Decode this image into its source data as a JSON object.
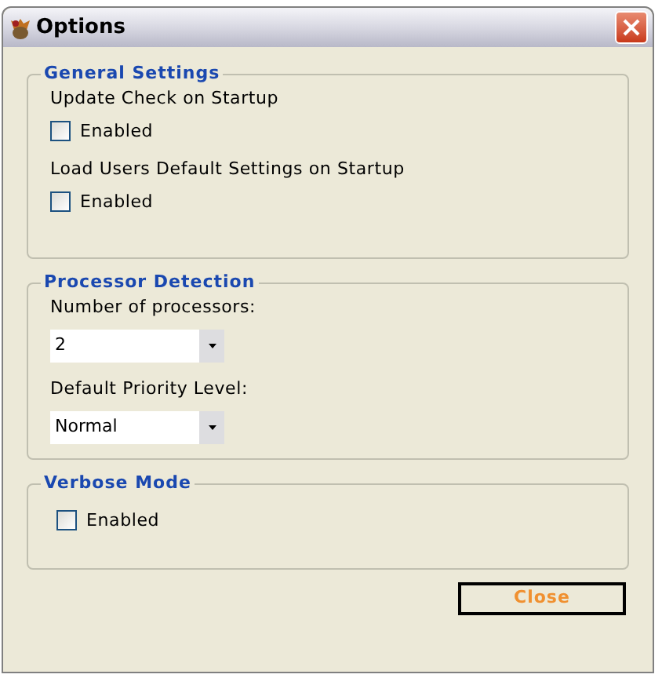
{
  "window": {
    "title": "Options"
  },
  "groups": [
    {
      "title": "General Settings",
      "items": [
        {
          "kind": "checkbox",
          "label": "Update Check on Startup",
          "option": "Enabled",
          "checked": false
        },
        {
          "kind": "checkbox",
          "label": "Load Users Default Settings on Startup",
          "option": "Enabled",
          "checked": false
        }
      ]
    },
    {
      "title": "Processor Detection",
      "items": [
        {
          "kind": "dropdown",
          "label": "Number of processors:",
          "value": "2"
        },
        {
          "kind": "dropdown",
          "label": "Default Priority Level:",
          "value": "Normal"
        }
      ]
    },
    {
      "title": "Verbose Mode",
      "items": [
        {
          "kind": "checkbox",
          "option": "Enabled",
          "checked": false
        }
      ]
    }
  ],
  "buttons": [
    "Close"
  ]
}
